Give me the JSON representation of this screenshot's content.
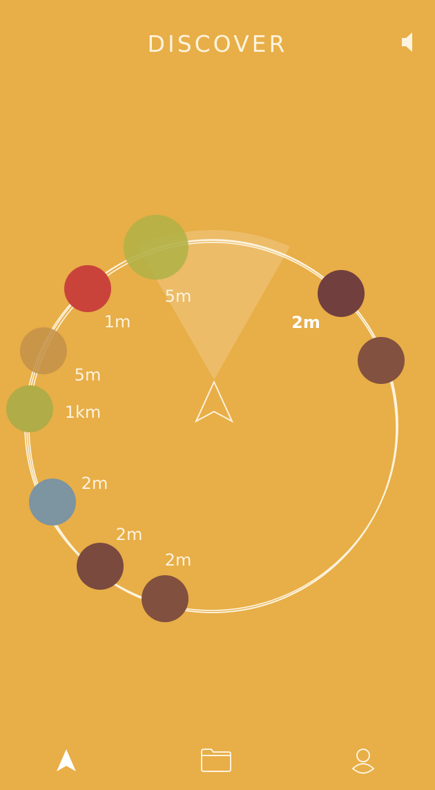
{
  "header": {
    "title": "DISCOVER",
    "sound_icon": "speaker-icon"
  },
  "radar": {
    "user_icon": "navigation-arrow-icon",
    "items": [
      {
        "label": "5m",
        "color": "#B2B247"
      },
      {
        "label": "1m",
        "color": "#C9433B"
      },
      {
        "label": "5m",
        "color": "#C39149"
      },
      {
        "label": "1km",
        "color": "#B0AC47"
      },
      {
        "label": "2m",
        "color": "#7D94A1"
      },
      {
        "label": "2m",
        "color": "#7A4A3F"
      },
      {
        "label": "2m",
        "color": "#82503F"
      },
      {
        "label": "2m",
        "color": "#723F3F"
      },
      {
        "label": "",
        "color": "#83513F"
      }
    ]
  },
  "tabbar": {
    "tabs": [
      {
        "name": "discover",
        "icon": "navigation-arrow-icon",
        "active": true
      },
      {
        "name": "library",
        "icon": "folder-icon",
        "active": false
      },
      {
        "name": "profile",
        "icon": "user-icon",
        "active": false
      }
    ]
  },
  "colors": {
    "background": "#E8AE47",
    "foreground": "#FCF3DE"
  }
}
